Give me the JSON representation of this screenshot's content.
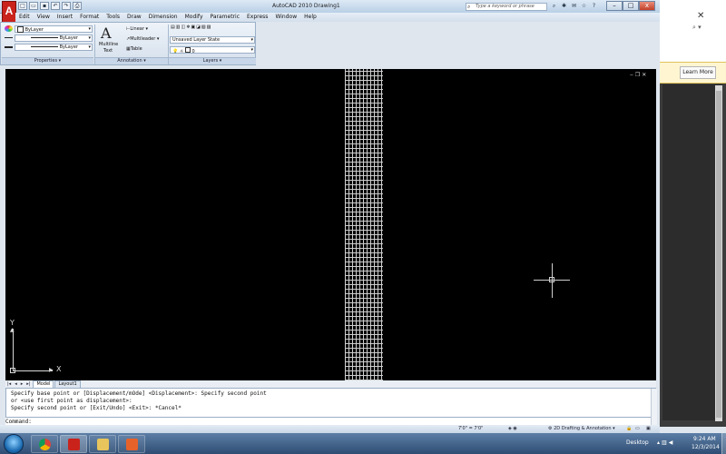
{
  "window": {
    "title": "AutoCAD 2010    Drawing1",
    "logo": "A",
    "search_placeholder": "Type a keyword or phrase",
    "controls": {
      "minimize": "–",
      "maximize": "□",
      "close": "x"
    }
  },
  "quick_access": [
    "new-icon",
    "open-icon",
    "save-icon",
    "undo-icon",
    "redo-icon",
    "plot-icon"
  ],
  "menus": [
    "Edit",
    "View",
    "Insert",
    "Format",
    "Tools",
    "Draw",
    "Dimension",
    "Modify",
    "Parametric",
    "Express",
    "Window",
    "Help"
  ],
  "ribbon": {
    "properties": {
      "title": "Properties",
      "color_value": "ByLayer",
      "linetype_value": "ByLayer",
      "lineweight_value": "ByLayer"
    },
    "annotation": {
      "title": "Annotation",
      "multiline_text_1": "Multiline",
      "multiline_text_2": "Text",
      "linear": "Linear",
      "multileader": "Multileader",
      "table": "Table"
    },
    "layers": {
      "title": "Layers",
      "layer_state": "Unsaved Layer State",
      "current_layer": "0"
    }
  },
  "sidebar_right": {
    "learn_more": "Learn More"
  },
  "tabs": {
    "nav": [
      "|◂",
      "◂",
      "▸",
      "▸|"
    ],
    "items": [
      "Model",
      "Layout1"
    ]
  },
  "ucs": {
    "x": "X",
    "y": "Y"
  },
  "command": {
    "lines": [
      "Specify base point or [Displacement/mOde] <Displacement>: Specify second point",
      "or <use first point as displacement>:",
      "Specify second point or [Exit/Undo] <Exit>: *Cancel*"
    ],
    "prompt": "Command:"
  },
  "status": {
    "coords": "7'0\" = 7'0\"",
    "workspace": "2D Drafting & Annotation"
  },
  "taskbar": {
    "desktop": "Desktop",
    "time": "9:24 AM",
    "date": "12/3/2014"
  }
}
